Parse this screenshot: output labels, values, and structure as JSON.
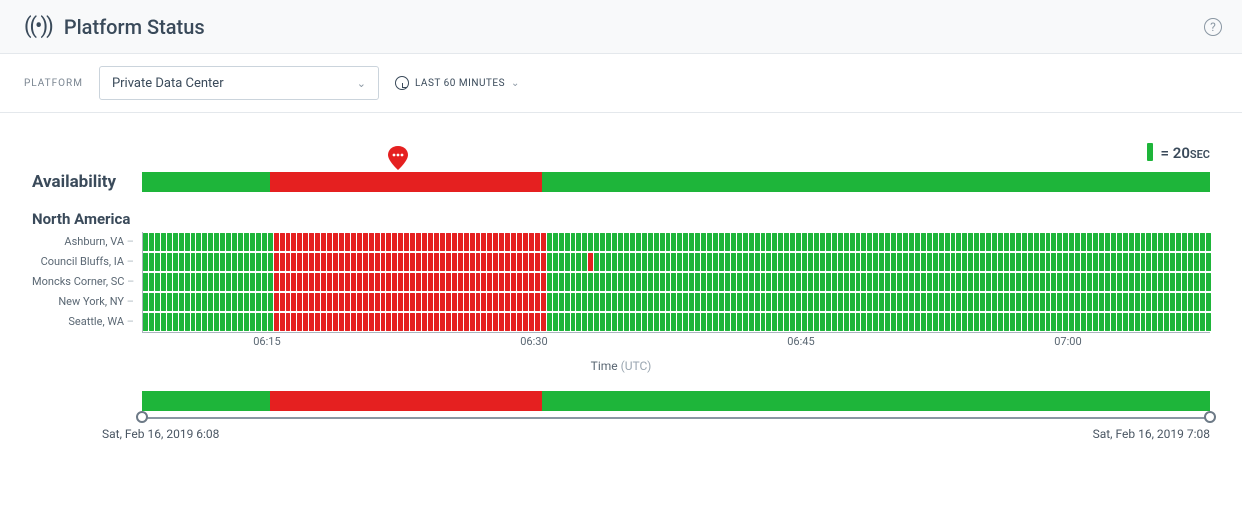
{
  "header": {
    "title": "Platform Status"
  },
  "toolbar": {
    "platform_label": "PLATFORM",
    "platform_value": "Private Data Center",
    "timerange_label": "LAST 60 MINUTES"
  },
  "legend": {
    "value": "20",
    "unit": "SEC"
  },
  "availability": {
    "label": "Availability",
    "outage_start_pct": 12,
    "outage_end_pct": 37.5,
    "marker_pct": 24
  },
  "chart_data": {
    "type": "heatmap",
    "title": "Availability",
    "xlabel": "Time (UTC)",
    "ylabel": "",
    "region": "North America",
    "locations": [
      "Ashburn, VA",
      "Council Bluffs, IA",
      "Moncks Corner, SC",
      "New York, NY",
      "Seattle, WA"
    ],
    "interval_sec": 20,
    "bins": 180,
    "x_ticks": [
      "06:15",
      "06:30",
      "06:45",
      "07:00"
    ],
    "x_tick_positions_pct": [
      11.7,
      36.7,
      61.7,
      86.7
    ],
    "outage_ranges": {
      "Ashburn, VA": [
        [
          22,
          67
        ]
      ],
      "Council Bluffs, IA": [
        [
          22,
          67
        ],
        [
          75,
          75
        ]
      ],
      "Moncks Corner, SC": [
        [
          22,
          67
        ]
      ],
      "New York, NY": [
        [
          22,
          67
        ]
      ],
      "Seattle, WA": [
        [
          22,
          67
        ]
      ]
    },
    "colors": {
      "up": "#1eb53a",
      "down": "#e52020"
    }
  },
  "xaxis": {
    "label_prefix": "Time",
    "label_suffix": "(UTC)"
  },
  "brush": {
    "start_label": "Sat, Feb 16, 2019 6:08",
    "end_label": "Sat, Feb 16, 2019 7:08",
    "outage_start_pct": 12,
    "outage_end_pct": 37.5
  }
}
